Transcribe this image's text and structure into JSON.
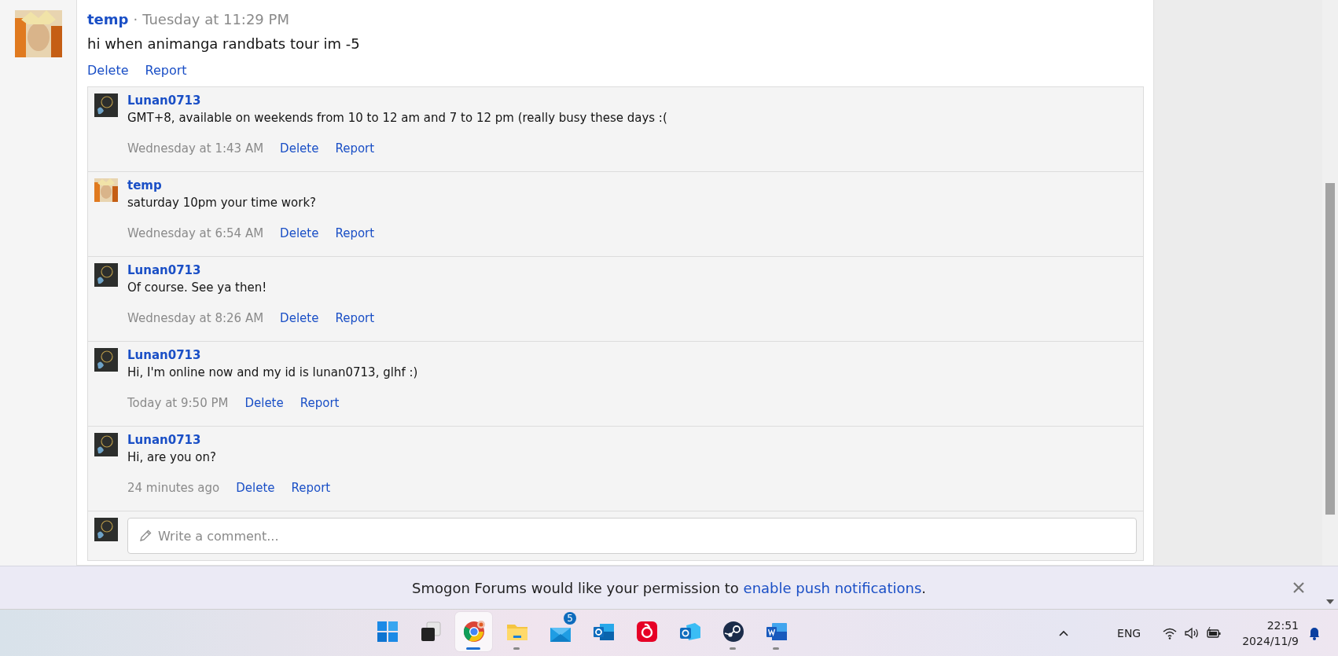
{
  "post": {
    "author": "temp",
    "separator": "·",
    "time": "Tuesday at 11:29 PM",
    "message": "hi when animanga randbats tour im -5",
    "actions": [
      "Delete",
      "Report"
    ],
    "avatar": {
      "kind": "warm"
    }
  },
  "comments": [
    {
      "author": "Lunan0713",
      "message": "GMT+8, available on weekends from 10 to 12 am and 7 to 12 pm (really busy these days :(",
      "time": "Wednesday at 1:43 AM",
      "actions": [
        "Delete",
        "Report"
      ],
      "avatar": {
        "kind": "dark"
      }
    },
    {
      "author": "temp",
      "message": "saturday 10pm your time work?",
      "time": "Wednesday at 6:54 AM",
      "actions": [
        "Delete",
        "Report"
      ],
      "avatar": {
        "kind": "warm"
      }
    },
    {
      "author": "Lunan0713",
      "message": "Of course. See ya then!",
      "time": "Wednesday at 8:26 AM",
      "actions": [
        "Delete",
        "Report"
      ],
      "avatar": {
        "kind": "dark"
      }
    },
    {
      "author": "Lunan0713",
      "message": "Hi, I'm online now and my id is lunan0713, glhf :)",
      "time": "Today at 9:50 PM",
      "actions": [
        "Delete",
        "Report"
      ],
      "avatar": {
        "kind": "dark"
      }
    },
    {
      "author": "Lunan0713",
      "message": "Hi, are you on?",
      "time": "24 minutes ago",
      "actions": [
        "Delete",
        "Report"
      ],
      "avatar": {
        "kind": "dark"
      }
    }
  ],
  "comment_field": {
    "placeholder": "Write a comment...",
    "avatar": {
      "kind": "dark"
    }
  },
  "notification_bar": {
    "text": "Smogon Forums would like your permission to ",
    "link": "enable push notifications",
    "end": "."
  },
  "taskbar": {
    "apps": [
      {
        "kind": "start",
        "selected": false,
        "running": false
      },
      {
        "kind": "taskview",
        "selected": false,
        "running": false
      },
      {
        "kind": "chrome",
        "selected": true,
        "running": true
      },
      {
        "kind": "folder",
        "selected": false,
        "running": true
      },
      {
        "kind": "mail",
        "selected": false,
        "running": false,
        "badge": "5"
      },
      {
        "kind": "outlook",
        "selected": false,
        "running": false
      },
      {
        "kind": "music",
        "selected": false,
        "running": false
      },
      {
        "kind": "outlook-new",
        "selected": false,
        "running": false
      },
      {
        "kind": "steam",
        "selected": false,
        "running": true
      },
      {
        "kind": "word",
        "selected": false,
        "running": true
      }
    ],
    "language": "ENG",
    "time": "22:51",
    "date": "2024/11/9"
  }
}
